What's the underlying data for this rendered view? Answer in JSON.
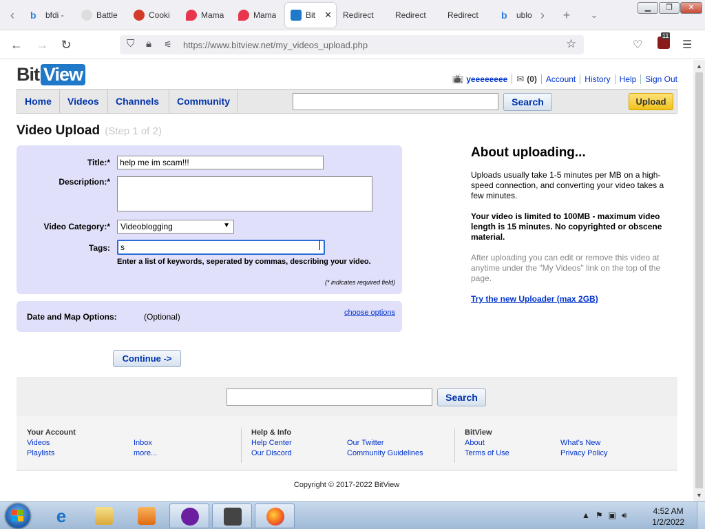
{
  "browser": {
    "tabs": [
      {
        "label": "bfdi -",
        "favicon_color": "#2b7de0",
        "active": false
      },
      {
        "label": "Battle",
        "favicon_color": "#bbbbbb",
        "active": false
      },
      {
        "label": "Cooki",
        "favicon_color": "#d23b2a",
        "active": false
      },
      {
        "label": "Mama",
        "favicon_color": "#e8364f",
        "active": false
      },
      {
        "label": "Mama",
        "favicon_color": "#e8364f",
        "active": false
      },
      {
        "label": "Bit",
        "favicon_color": "#1f78c8",
        "active": true
      },
      {
        "label": "Redirect",
        "favicon_color": "",
        "active": false
      },
      {
        "label": "Redirect",
        "favicon_color": "",
        "active": false
      },
      {
        "label": "Redirect",
        "favicon_color": "",
        "active": false
      },
      {
        "label": "ublo",
        "favicon_color": "#2b7de0",
        "active": false
      }
    ],
    "url": "https://www.bitview.net/my_videos_upload.php",
    "extension_badge_count": "11"
  },
  "site": {
    "logo_bit": "Bit",
    "logo_view": "View",
    "user": {
      "username": "yeeeeeeee",
      "mail_count": "(0)",
      "links": [
        "Account",
        "History",
        "Help",
        "Sign Out"
      ]
    },
    "nav": [
      "Home",
      "Videos",
      "Channels",
      "Community"
    ],
    "search_label": "Search",
    "upload_label": "Upload"
  },
  "upload": {
    "title": "Video Upload",
    "step": "(Step 1 of 2)",
    "fields": {
      "title_label": "Title:*",
      "title_value": "help me im scam!!!",
      "description_label": "Description:*",
      "description_value": "",
      "category_label": "Video Category:*",
      "category_value": "Videoblogging",
      "tags_label": "Tags:",
      "tags_value": "s"
    },
    "tags_help": "Enter a list of keywords, seperated by commas, describing your video.",
    "required_note": "(* indicates required field)",
    "date_map": {
      "label": "Date and Map Options:",
      "optional": "(Optional)",
      "link": "choose options"
    },
    "continue_label": "Continue ->"
  },
  "about": {
    "heading": "About uploading...",
    "p1": "Uploads usually take 1-5 minutes per MB on a high-speed connection, and converting your video takes a few minutes.",
    "p2": "Your video is limited to 100MB - maximum video length is 15 minutes. No copyrighted or obscene material.",
    "p3": "After uploading you can edit or remove this video at anytime under the \"My Videos\" link on the top of the page.",
    "link": "Try the new Uploader (max 2GB)"
  },
  "footer": {
    "search_label": "Search",
    "your_account": {
      "heading": "Your Account",
      "links": [
        "Videos",
        "Playlists",
        "Inbox",
        "more..."
      ]
    },
    "help_info": {
      "heading": "Help & Info",
      "links": [
        "Help Center",
        "Our Discord",
        "Our Twitter",
        "Community Guidelines"
      ]
    },
    "bitview": {
      "heading": "BitView",
      "links": [
        "About",
        "Terms of Use",
        "What's New",
        "Privacy Policy"
      ]
    },
    "copyright": "Copyright © 2017-2022 BitView"
  },
  "taskbar": {
    "time": "4:52 AM",
    "date": "1/2/2022"
  }
}
